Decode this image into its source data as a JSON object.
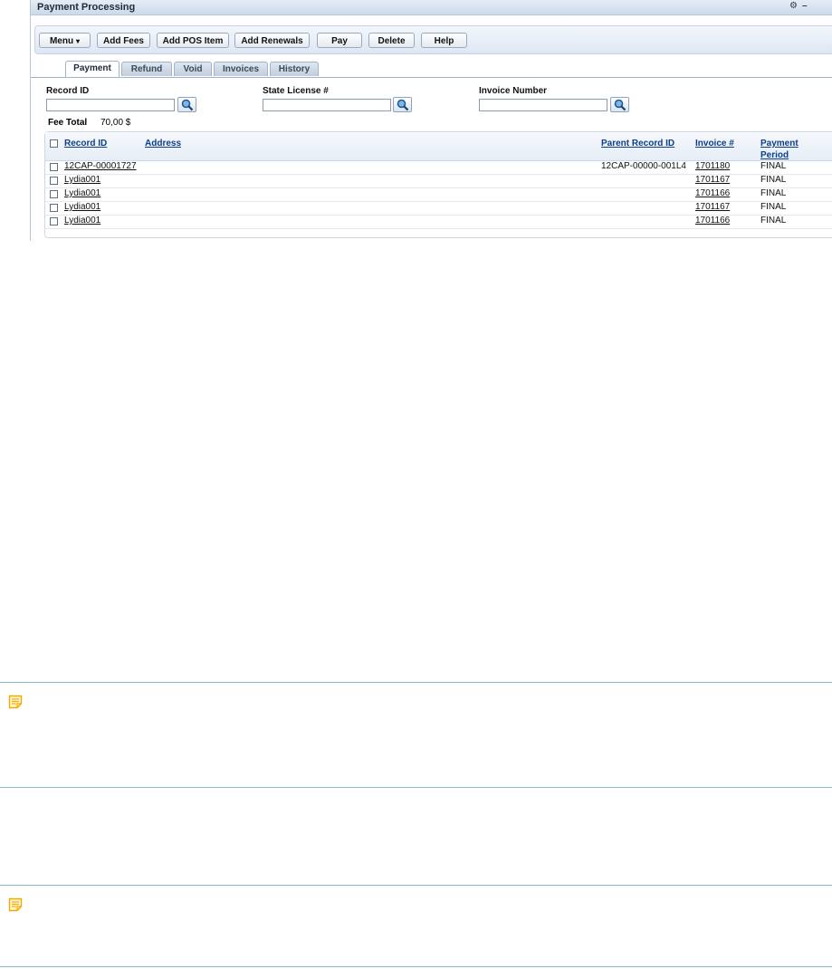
{
  "portlet": {
    "title": "Payment Processing",
    "controls": {
      "settings_glyph": "⚙",
      "minimize_glyph": "–"
    }
  },
  "toolbar": {
    "menu": "Menu",
    "menu_caret": "▾",
    "add_fees": "Add Fees",
    "add_pos_item": "Add POS Item",
    "add_renewals": "Add Renewals",
    "pay": "Pay",
    "delete": "Delete",
    "help": "Help"
  },
  "tabs": [
    "Payment",
    "Refund",
    "Void",
    "Invoices",
    "History"
  ],
  "active_tab": "Payment",
  "search": {
    "record_id": {
      "label": "Record ID",
      "value": ""
    },
    "state_license": {
      "label": "State License #",
      "value": ""
    },
    "invoice_number": {
      "label": "Invoice Number",
      "value": ""
    }
  },
  "fee_total": {
    "label": "Fee Total",
    "value": "70,00 $"
  },
  "table": {
    "headers": {
      "record_id": "Record ID",
      "address": "Address",
      "parent_record_id": "Parent Record ID",
      "invoice": "Invoice #",
      "payment_period_1": "Payment",
      "payment_period_2": "Period"
    },
    "rows": [
      {
        "record_id": "12CAP-00001727",
        "address": "",
        "parent": "12CAP-00000-001L4",
        "invoice": "1701180",
        "period": "FINAL"
      },
      {
        "record_id": "Lydia001",
        "address": "",
        "parent": "",
        "invoice": "1701167",
        "period": "FINAL"
      },
      {
        "record_id": "Lydia001",
        "address": "",
        "parent": "",
        "invoice": "1701166",
        "period": "FINAL"
      },
      {
        "record_id": "Lydia001",
        "address": "",
        "parent": "",
        "invoice": "1701167",
        "period": "FINAL"
      },
      {
        "record_id": "Lydia001",
        "address": "",
        "parent": "",
        "invoice": "1701166",
        "period": "FINAL"
      }
    ]
  },
  "notes": [
    {
      "icon": "note-icon"
    },
    {
      "icon": "note-icon"
    }
  ],
  "colors": {
    "header_link": "#0b3f8a",
    "note_icon": "#f2a900",
    "rule": "#8fb8c9"
  }
}
